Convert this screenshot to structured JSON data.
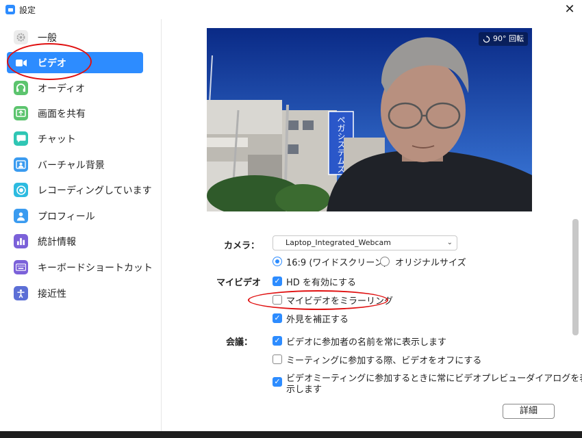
{
  "window": {
    "title": "設定",
    "close": "✕"
  },
  "sidebar": {
    "items": [
      {
        "label": "一般",
        "icon": "gear-icon",
        "color": "#b4b4b4"
      },
      {
        "label": "ビデオ",
        "icon": "video-camera-icon",
        "color": "#2d8cff",
        "active": true
      },
      {
        "label": "オーディオ",
        "icon": "headphones-icon",
        "color": "#5cc46e"
      },
      {
        "label": "画面を共有",
        "icon": "share-screen-icon",
        "color": "#5cc46e"
      },
      {
        "label": "チャット",
        "icon": "chat-bubble-icon",
        "color": "#2fc6b4"
      },
      {
        "label": "バーチャル背景",
        "icon": "person-card-icon",
        "color": "#3a9bf0"
      },
      {
        "label": "レコーディングしています",
        "icon": "record-icon",
        "color": "#2dbbe0"
      },
      {
        "label": "プロフィール",
        "icon": "person-icon",
        "color": "#3a9bf0"
      },
      {
        "label": "統計情報",
        "icon": "bar-chart-icon",
        "color": "#7b61d9"
      },
      {
        "label": "キーボードショートカット",
        "icon": "keyboard-icon",
        "color": "#7b61d9"
      },
      {
        "label": "接近性",
        "icon": "accessibility-icon",
        "color": "#5c6fd6"
      }
    ]
  },
  "preview": {
    "rotate_label": "90° 回転",
    "sign_text": "ペガシステムズ"
  },
  "camera": {
    "label": "カメラ：",
    "selected": "Laptop_Integrated_Webcam"
  },
  "aspect": {
    "wide": "16:9 (ワイドスクリーン)",
    "original": "オリジナルサイズ",
    "selected": "wide"
  },
  "my_video": {
    "label": "マイビデオ",
    "options": [
      {
        "label": "HD を有効にする",
        "checked": true
      },
      {
        "label": "マイビデオをミラーリング",
        "checked": false
      },
      {
        "label": "外見を補正する",
        "checked": true
      }
    ]
  },
  "meeting": {
    "label": "会議：",
    "options": [
      {
        "label": "ビデオに参加者の名前を常に表示します",
        "checked": true
      },
      {
        "label": "ミーティングに参加する際、ビデオをオフにする",
        "checked": false
      },
      {
        "label_line1": "ビデオミーティングに参加するときに常にビデオプレビューダイアログを表",
        "label_line2": "示します",
        "checked": true
      }
    ]
  },
  "detail_button": "詳細",
  "colors": {
    "accent": "#2d8cff",
    "annotation": "#e01010"
  }
}
